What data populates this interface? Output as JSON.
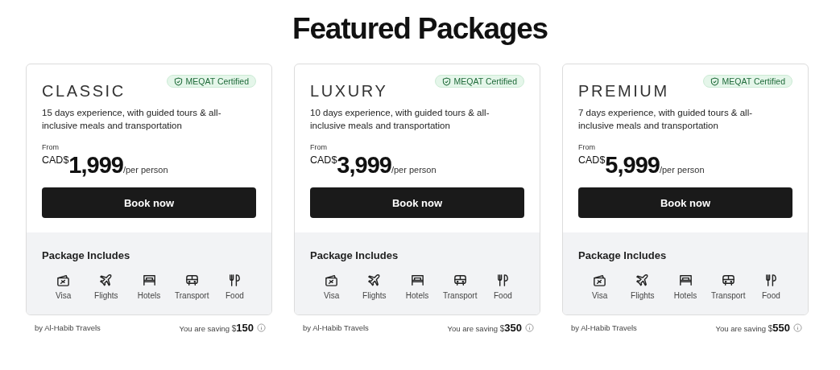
{
  "heading": "Featured Packages",
  "packages": [
    {
      "name": "CLASSIC",
      "badge": "MEQAT Certified",
      "description": "15 days experience, with guided tours & all-inclusive meals and transportation",
      "from": "From",
      "currency": "CAD$",
      "price": "1,999",
      "unit": "/per person",
      "button": "Book now",
      "includes_title": "Package Includes",
      "includes": [
        {
          "kind": "visa",
          "label": "Visa"
        },
        {
          "kind": "flights",
          "label": "Flights"
        },
        {
          "kind": "hotels",
          "label": "Hotels"
        },
        {
          "kind": "transport",
          "label": "Transport"
        },
        {
          "kind": "food",
          "label": "Food"
        }
      ],
      "agency": "by Al-Habib Travels",
      "saving_label": "You are saving",
      "saving_currency": "$",
      "saving_amount": "150"
    },
    {
      "name": "LUXURY",
      "badge": "MEQAT Certified",
      "description": "10 days experience, with guided tours & all-inclusive meals and transportation",
      "from": "From",
      "currency": "CAD$",
      "price": "3,999",
      "unit": "/per person",
      "button": "Book now",
      "includes_title": "Package Includes",
      "includes": [
        {
          "kind": "visa",
          "label": "Visa"
        },
        {
          "kind": "flights",
          "label": "Flights"
        },
        {
          "kind": "hotels",
          "label": "Hotels"
        },
        {
          "kind": "transport",
          "label": "Transport"
        },
        {
          "kind": "food",
          "label": "Food"
        }
      ],
      "agency": "by Al-Habib Travels",
      "saving_label": "You are saving",
      "saving_currency": "$",
      "saving_amount": "350"
    },
    {
      "name": "PREMIUM",
      "badge": "MEQAT Certified",
      "description": "7 days experience, with guided tours & all-inclusive meals and transportation",
      "from": "From",
      "currency": "CAD$",
      "price": "5,999",
      "unit": "/per person",
      "button": "Book now",
      "includes_title": "Package Includes",
      "includes": [
        {
          "kind": "visa",
          "label": "Visa"
        },
        {
          "kind": "flights",
          "label": "Flights"
        },
        {
          "kind": "hotels",
          "label": "Hotels"
        },
        {
          "kind": "transport",
          "label": "Transport"
        },
        {
          "kind": "food",
          "label": "Food"
        }
      ],
      "agency": "by Al-Habib Travels",
      "saving_label": "You are saving",
      "saving_currency": "$",
      "saving_amount": "550"
    }
  ]
}
